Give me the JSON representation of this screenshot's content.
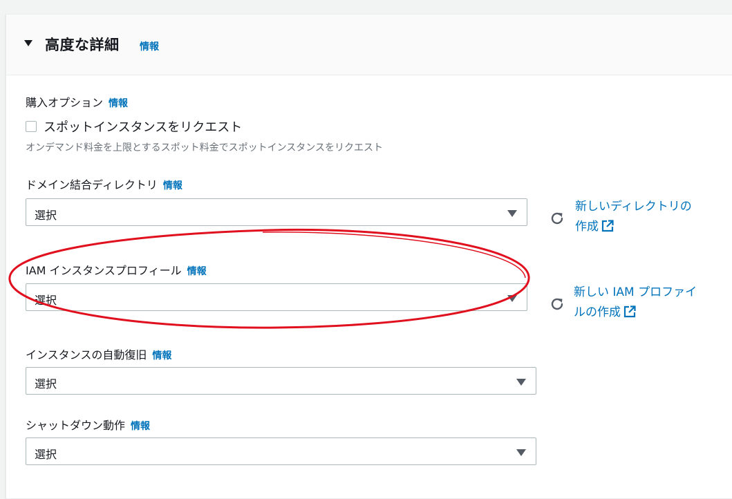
{
  "panel": {
    "title": "高度な詳細",
    "info": "情報"
  },
  "purchase": {
    "label": "購入オプション",
    "info": "情報",
    "checkbox_label": "スポットインスタンスをリクエスト",
    "checked": false,
    "description": "オンデマンド料金を上限とするスポット料金でスポットインスタンスをリクエスト"
  },
  "domain_dir": {
    "label": "ドメイン結合ディレクトリ",
    "info": "情報",
    "value": "選択",
    "link_line1": "新しいディレクトリの",
    "link_line2": "作成"
  },
  "iam_profile": {
    "label": "IAM インスタンスプロフィール",
    "info": "情報",
    "value": "選択",
    "link_line1": "新しい IAM プロファイ",
    "link_line2": "ルの作成"
  },
  "auto_recovery": {
    "label": "インスタンスの自動復旧",
    "info": "情報",
    "value": "選択"
  },
  "shutdown": {
    "label": "シャットダウン動作",
    "info": "情報",
    "value": "選択"
  },
  "colors": {
    "link": "#0073bb",
    "annotation": "#e0101e"
  }
}
